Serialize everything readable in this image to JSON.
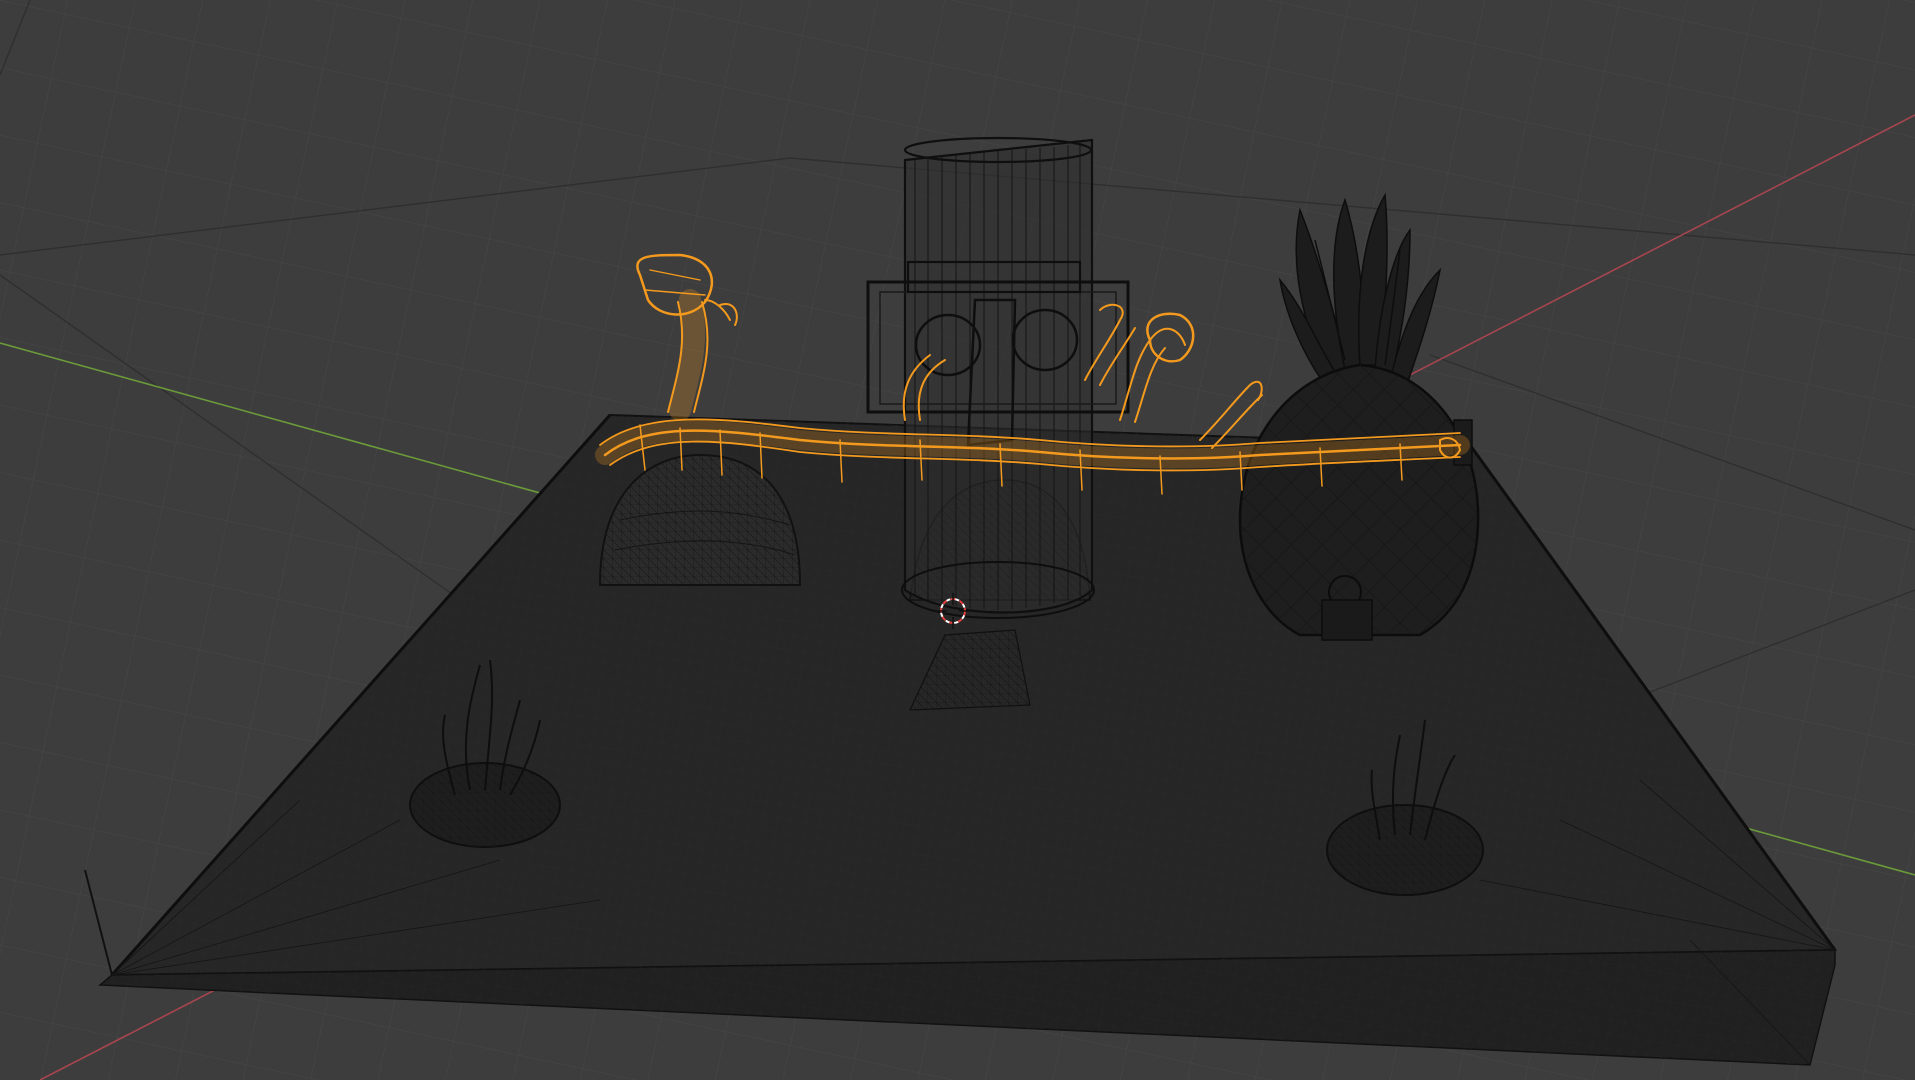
{
  "viewport": {
    "mode": "wireframe",
    "background_color": "#3d3d3d",
    "grid_color": "#4b4b4b",
    "grid_major_color": "#2e2e2e",
    "x_axis_color": "#a8454f",
    "y_axis_color": "#6b9a3a",
    "wire_color": "#111111",
    "selected_wire_color": "#f39a1e",
    "cursor_color": "#e63d3d"
  },
  "scene": {
    "objects": [
      {
        "name": "seabed-plane",
        "type": "mesh",
        "selected": false
      },
      {
        "name": "tiki-head-house",
        "type": "mesh",
        "selected": false
      },
      {
        "name": "pineapple-house",
        "type": "mesh",
        "selected": false
      },
      {
        "name": "rock-dome-house",
        "type": "mesh",
        "selected": false
      },
      {
        "name": "coral-pipes",
        "type": "mesh",
        "selected": true
      },
      {
        "name": "seaweed-left",
        "type": "mesh",
        "selected": false
      },
      {
        "name": "seaweed-right",
        "type": "mesh",
        "selected": false
      }
    ],
    "icons": {
      "cursor": "3d-cursor-icon"
    }
  }
}
